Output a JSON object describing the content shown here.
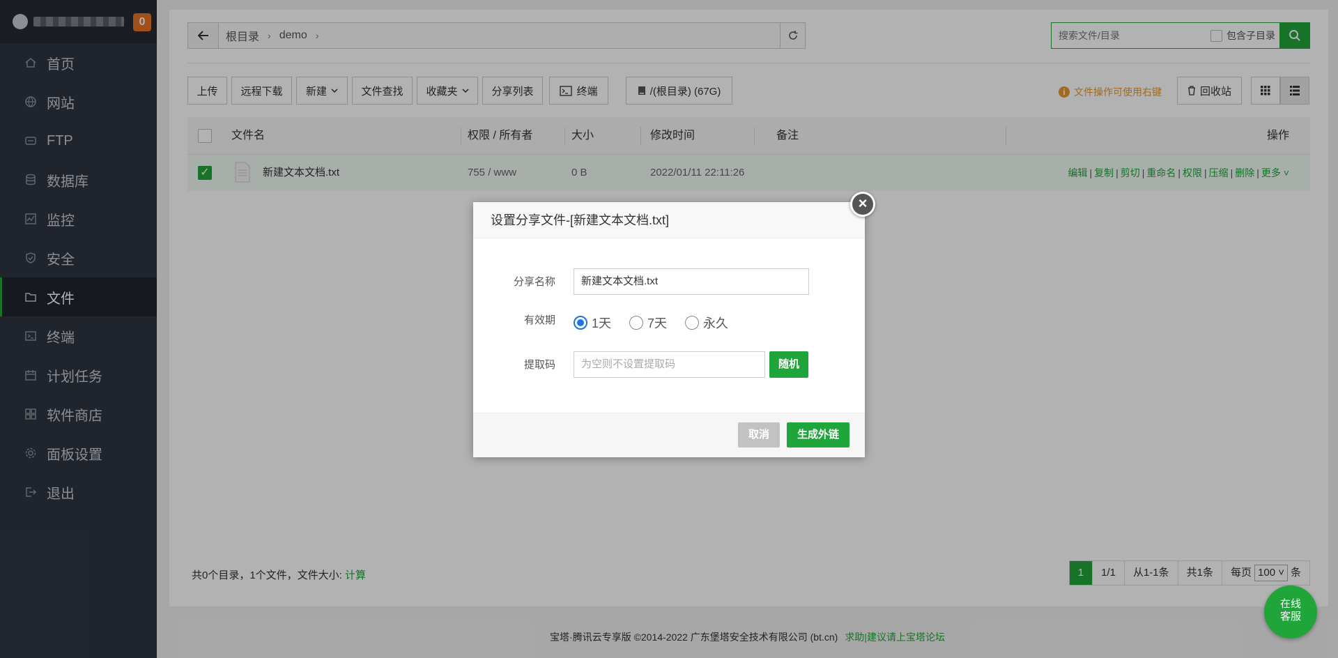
{
  "sidebar": {
    "badge": "0",
    "items": [
      {
        "label": "首页",
        "icon": "home-icon"
      },
      {
        "label": "网站",
        "icon": "globe-icon"
      },
      {
        "label": "FTP",
        "icon": "ftp-icon"
      },
      {
        "label": "数据库",
        "icon": "database-icon"
      },
      {
        "label": "监控",
        "icon": "monitor-icon"
      },
      {
        "label": "安全",
        "icon": "shield-icon"
      },
      {
        "label": "文件",
        "icon": "folder-icon"
      },
      {
        "label": "终端",
        "icon": "terminal-icon"
      },
      {
        "label": "计划任务",
        "icon": "calendar-icon"
      },
      {
        "label": "软件商店",
        "icon": "apps-icon"
      },
      {
        "label": "面板设置",
        "icon": "gear-icon"
      },
      {
        "label": "退出",
        "icon": "logout-icon"
      }
    ],
    "active": "文件"
  },
  "path": {
    "crumbs": [
      "根目录",
      "demo"
    ]
  },
  "search": {
    "placeholder": "搜索文件/目录",
    "subdir_label": "包含子目录"
  },
  "toolbar": {
    "upload": "上传",
    "remote_download": "远程下载",
    "new": "新建",
    "file_search": "文件查找",
    "favorites": "收藏夹",
    "share_list": "分享列表",
    "terminal": "终端",
    "disk": "/(根目录) (67G)",
    "tip": "文件操作可使用右键",
    "recycle": "回收站"
  },
  "table": {
    "headers": {
      "name": "文件名",
      "perm": "权限 / 所有者",
      "size": "大小",
      "mtime": "修改时间",
      "note": "备注",
      "ops": "操作"
    },
    "rows": [
      {
        "name": "新建文本文档.txt",
        "perm": "755 / www",
        "size": "0 B",
        "mtime": "2022/01/11 22:11:26",
        "note": "",
        "checked": true
      }
    ],
    "ops": [
      "编辑",
      "复制",
      "剪切",
      "重命名",
      "权限",
      "压缩",
      "删除",
      "更多"
    ]
  },
  "summary": {
    "text": "共0个目录，1个文件，文件大小:",
    "calc": "计算"
  },
  "pager": {
    "current": "1",
    "pages": "1/1",
    "range": "从1-1条",
    "total": "共1条",
    "per_page_label": "每页",
    "per_page": "100",
    "unit": "条"
  },
  "copyright": {
    "text": "宝塔·腾讯云专享版 ©2014-2022 广东堡塔安全技术有限公司 (bt.cn)",
    "link": "求助|建议请上宝塔论坛"
  },
  "chat": {
    "line1": "在线",
    "line2": "客服"
  },
  "modal": {
    "title": "设置分享文件-[新建文本文档.txt]",
    "share_name_label": "分享名称",
    "share_name_value": "新建文本文档.txt",
    "validity_label": "有效期",
    "validity_options": [
      "1天",
      "7天",
      "永久"
    ],
    "validity_selected": "1天",
    "code_label": "提取码",
    "code_placeholder": "为空则不设置提取码",
    "random_btn": "随机",
    "cancel_btn": "取消",
    "generate_btn": "生成外链"
  },
  "colors": {
    "accent": "#20a53a",
    "sidebar_bg": "#2f3541",
    "badge": "#e57323",
    "tip": "#e69a30"
  }
}
